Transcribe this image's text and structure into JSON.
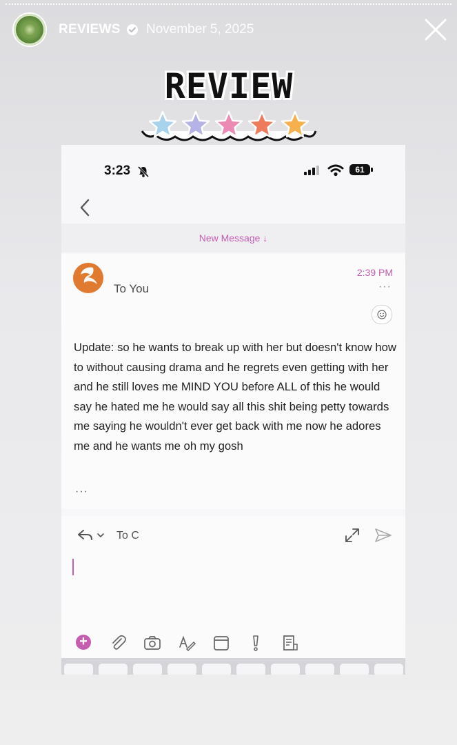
{
  "story": {
    "account_name": "REVIEWS",
    "date": "November 5, 2025",
    "close_icon": "close-icon",
    "verified_icon": "verified-badge-icon"
  },
  "sticker": {
    "title": "REVIEW",
    "star_colors": [
      "#a8d3ec",
      "#b5b3e6",
      "#ec8ab4",
      "#f07a5c",
      "#f6b14d"
    ]
  },
  "phone": {
    "status": {
      "time": "3:23",
      "battery": "61"
    },
    "new_message_label": "New Message ↓",
    "email": {
      "to_label": "To You",
      "time": "2:39 PM",
      "more": "···",
      "body": "Update: so he wants to break up with her but doesn't know how to without causing drama and he regrets even getting with her and he still loves me MIND YOU before ALL of this he would say he hated me he would say all this shit being petty towards me saying he wouldn't ever get back with me now he adores me and he wants me oh my gosh",
      "collapsed_more": "···"
    },
    "reply": {
      "to_label": "To C"
    }
  },
  "colors": {
    "accent": "#c55db1",
    "sender_logo": "#e07a2e"
  }
}
